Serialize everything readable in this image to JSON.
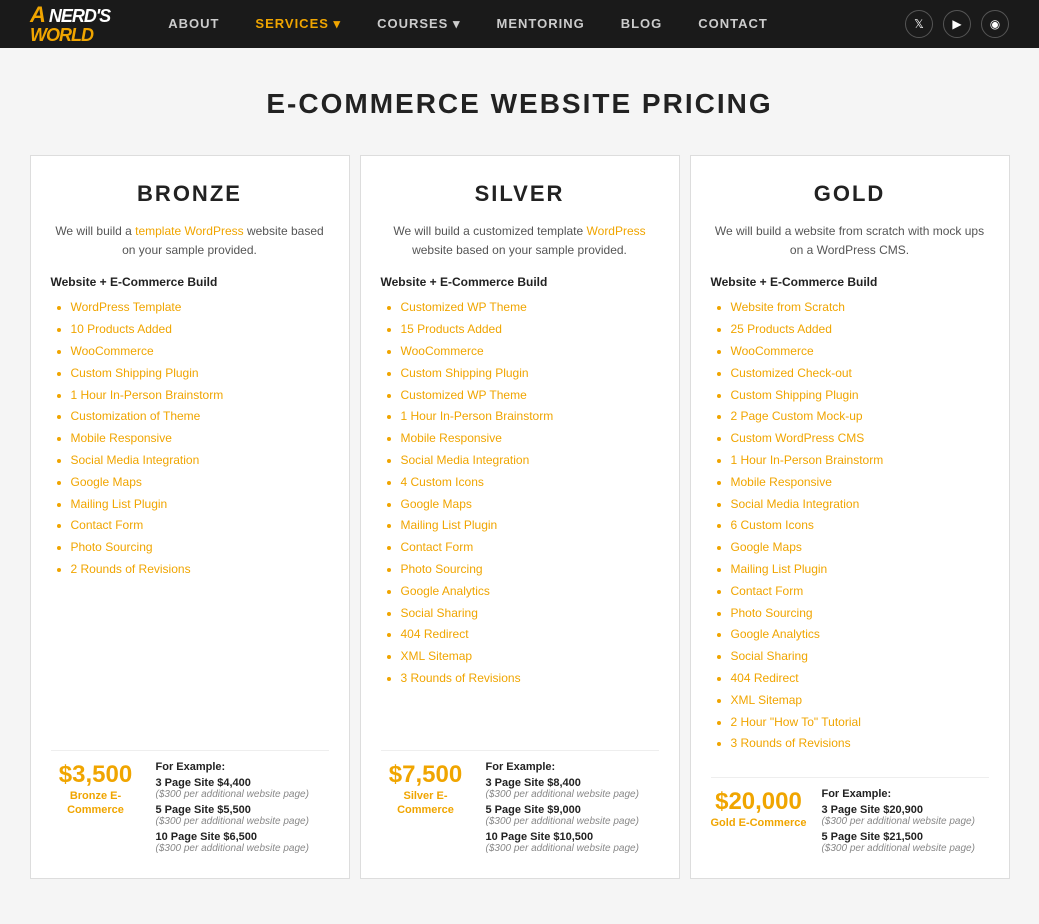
{
  "nav": {
    "logo": {
      "line1": "A NERD'S",
      "line2": "WORLD"
    },
    "links": [
      {
        "label": "ABOUT",
        "active": false,
        "hasDropdown": false
      },
      {
        "label": "SERVICES",
        "active": true,
        "hasDropdown": true
      },
      {
        "label": "COURSES",
        "active": false,
        "hasDropdown": true
      },
      {
        "label": "MENTORING",
        "active": false,
        "hasDropdown": false
      },
      {
        "label": "BLOG",
        "active": false,
        "hasDropdown": false
      },
      {
        "label": "CONTACT",
        "active": false,
        "hasDropdown": false
      }
    ],
    "social": [
      {
        "name": "twitter",
        "icon": "𝕏"
      },
      {
        "name": "youtube",
        "icon": "▶"
      },
      {
        "name": "instagram",
        "icon": "◉"
      }
    ]
  },
  "page": {
    "title": "E-COMMERCE WEBSITE PRICING"
  },
  "plans": [
    {
      "id": "bronze",
      "title": "BRONZE",
      "description": "We will build a template WordPress website based on your sample provided.",
      "sectionHeader": "Website + E-Commerce Build",
      "features": [
        "WordPress Template",
        "10 Products Added",
        "WooCommerce",
        "Custom Shipping Plugin",
        "1 Hour In-Person Brainstorm",
        "Customization of Theme",
        "Mobile Responsive",
        "Social Media Integration",
        "Google Maps",
        "Mailing List Plugin",
        "Contact Form",
        "Photo Sourcing",
        "2 Rounds of Revisions"
      ],
      "bigPrice": {
        "amount": "$3,500",
        "label": "Bronze E-\nCommerce"
      },
      "examplesLabel": "For Example:",
      "examples": [
        {
          "line": "3 Page Site $4,400",
          "note": "($300 per additional website page)"
        },
        {
          "line": "5 Page Site $5,500",
          "note": "($300 per additional website page)"
        },
        {
          "line": "10 Page Site $6,500",
          "note": "($300 per additional website page)"
        }
      ]
    },
    {
      "id": "silver",
      "title": "SILVER",
      "description": "We will build a customized template WordPress website based on your sample provided.",
      "sectionHeader": "Website + E-Commerce Build",
      "features": [
        "Customized WP Theme",
        "15 Products Added",
        "WooCommerce",
        "Custom Shipping Plugin",
        "Customized WP Theme",
        "1 Hour In-Person Brainstorm",
        "Mobile Responsive",
        "Social Media Integration",
        "4 Custom Icons",
        "Google Maps",
        "Mailing List Plugin",
        "Contact Form",
        "Photo Sourcing",
        "Google Analytics",
        "Social Sharing",
        "404 Redirect",
        "XML Sitemap",
        "3 Rounds of Revisions"
      ],
      "bigPrice": {
        "amount": "$7,500",
        "label": "Silver E-\nCommerce"
      },
      "examplesLabel": "For Example:",
      "examples": [
        {
          "line": "3 Page Site $8,400",
          "note": "($300 per additional website page)"
        },
        {
          "line": "5 Page Site $9,000",
          "note": "($300 per additional website page)"
        },
        {
          "line": "10 Page Site $10,500",
          "note": "($300 per additional website page)"
        }
      ]
    },
    {
      "id": "gold",
      "title": "GOLD",
      "description": "We will build a website from scratch with mock ups on a WordPress CMS.",
      "sectionHeader": "Website + E-Commerce Build",
      "features": [
        "Website from Scratch",
        "25 Products Added",
        "WooCommerce",
        "Customized Check-out",
        "Custom Shipping Plugin",
        "2 Page Custom Mock-up",
        "Custom WordPress CMS",
        "1 Hour In-Person Brainstorm",
        "Mobile Responsive",
        "Social Media Integration",
        "6 Custom Icons",
        "Google Maps",
        "Mailing List Plugin",
        "Contact Form",
        "Photo Sourcing",
        "Google Analytics",
        "Social Sharing",
        "404 Redirect",
        "XML Sitemap",
        "2 Hour \"How To\" Tutorial",
        "3 Rounds of Revisions"
      ],
      "bigPrice": {
        "amount": "$20,000",
        "label": "Gold E-Commerce"
      },
      "examplesLabel": "For Example:",
      "examples": [
        {
          "line": "3 Page Site $20,900",
          "note": "($300 per additional website page)"
        },
        {
          "line": "5 Page Site $21,500",
          "note": "($300 per additional website page)"
        }
      ]
    }
  ]
}
